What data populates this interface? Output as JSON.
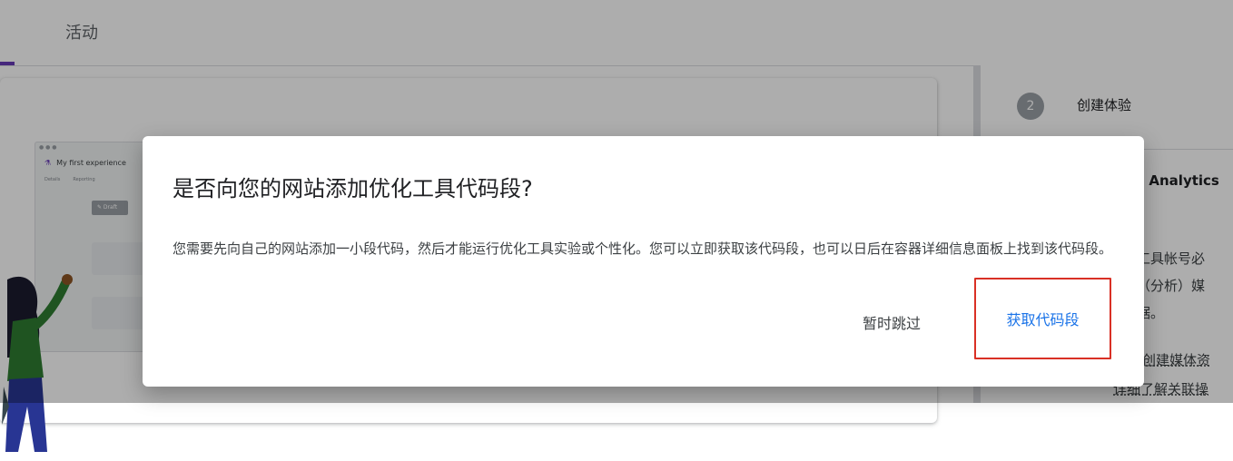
{
  "tabs": {
    "activity": "活动"
  },
  "mockup": {
    "title": "My first experience",
    "tab1": "Details",
    "tab2": "Reporting",
    "chip": "✎ Draft"
  },
  "side_panel": {
    "step_number": "2",
    "step_title": "创建体验",
    "heading_fragment": "e Analytics",
    "line1": "工具帐号必",
    "line2": "（分析）媒",
    "line3": "据。",
    "link1": "创建媒体资",
    "link2": "详细了解关联操"
  },
  "dialog": {
    "title": "是否向您的网站添加优化工具代码段?",
    "body": "您需要先向自己的网站添加一小段代码，然后才能运行优化工具实验或个性化。您可以立即获取该代码段，也可以日后在容器详细信息面板上找到该代码段。",
    "skip_label": "暂时跳过",
    "get_label": "获取代码段"
  },
  "colors": {
    "accent": "#673ab7",
    "primary_button_text": "#1a73e8",
    "highlight_box": "#d93025"
  }
}
